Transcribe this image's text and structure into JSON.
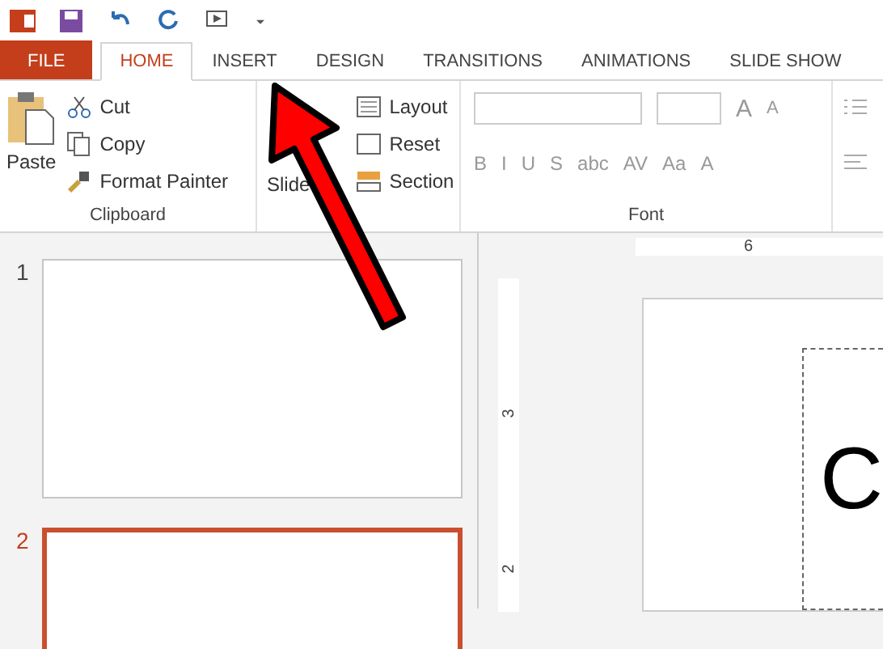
{
  "tabs": [
    {
      "label": "FILE",
      "kind": "file",
      "selected": false
    },
    {
      "label": "HOME",
      "kind": "tab",
      "selected": true
    },
    {
      "label": "INSERT",
      "kind": "tab",
      "selected": false
    },
    {
      "label": "DESIGN",
      "kind": "tab",
      "selected": false
    },
    {
      "label": "TRANSITIONS",
      "kind": "tab",
      "selected": false
    },
    {
      "label": "ANIMATIONS",
      "kind": "tab",
      "selected": false
    },
    {
      "label": "SLIDE SHOW",
      "kind": "tab",
      "selected": false
    }
  ],
  "clipboard": {
    "paste": "Paste",
    "cut": "Cut",
    "copy": "Copy",
    "format_painter": "Format Painter",
    "label": "Clipboard"
  },
  "slides_group": {
    "new_slide": "Slide",
    "layout": "Layout",
    "reset": "Reset",
    "section": "Section"
  },
  "font": {
    "label": "Font",
    "format_buttons": [
      "B",
      "I",
      "U",
      "S",
      "abc",
      "AV",
      "Aa",
      "A"
    ],
    "grow": "A",
    "shrink": "A"
  },
  "thumbnails": [
    {
      "number": "1",
      "selected": false
    },
    {
      "number": "2",
      "selected": true
    }
  ],
  "horizontal_ruler": {
    "label": "6"
  },
  "vertical_ruler": {
    "labels": [
      "3",
      "2"
    ]
  },
  "slide": {
    "text": "C"
  }
}
